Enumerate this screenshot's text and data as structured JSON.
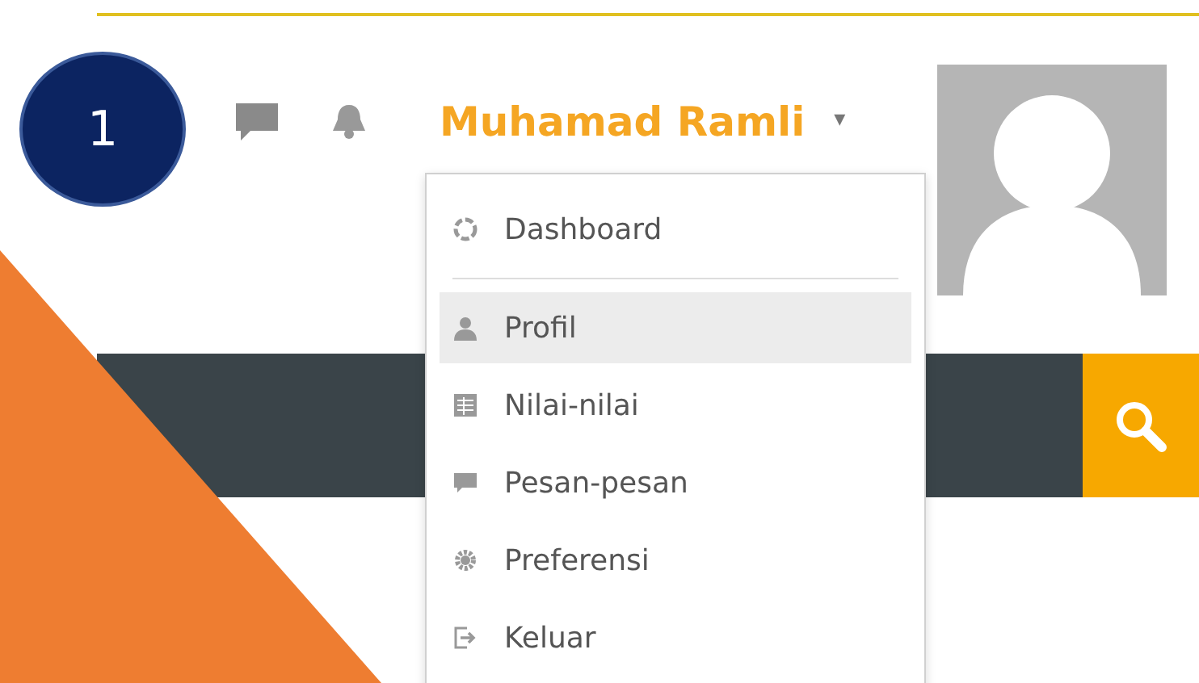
{
  "step_badge": "1",
  "user_menu": {
    "name": "Muhamad Ramli",
    "caret": "▾"
  },
  "dropdown": {
    "groups": [
      [
        {
          "label": "Dashboard",
          "kind": "dashboard",
          "selected": false
        }
      ],
      [
        {
          "label": "Profil",
          "kind": "user",
          "selected": true
        },
        {
          "label": "Nilai-nilai",
          "kind": "grades",
          "selected": false
        },
        {
          "label": "Pesan-pesan",
          "kind": "chat",
          "selected": false
        },
        {
          "label": "Preferensi",
          "kind": "gear",
          "selected": false
        },
        {
          "label": "Keluar",
          "kind": "logout",
          "selected": false
        }
      ]
    ]
  }
}
